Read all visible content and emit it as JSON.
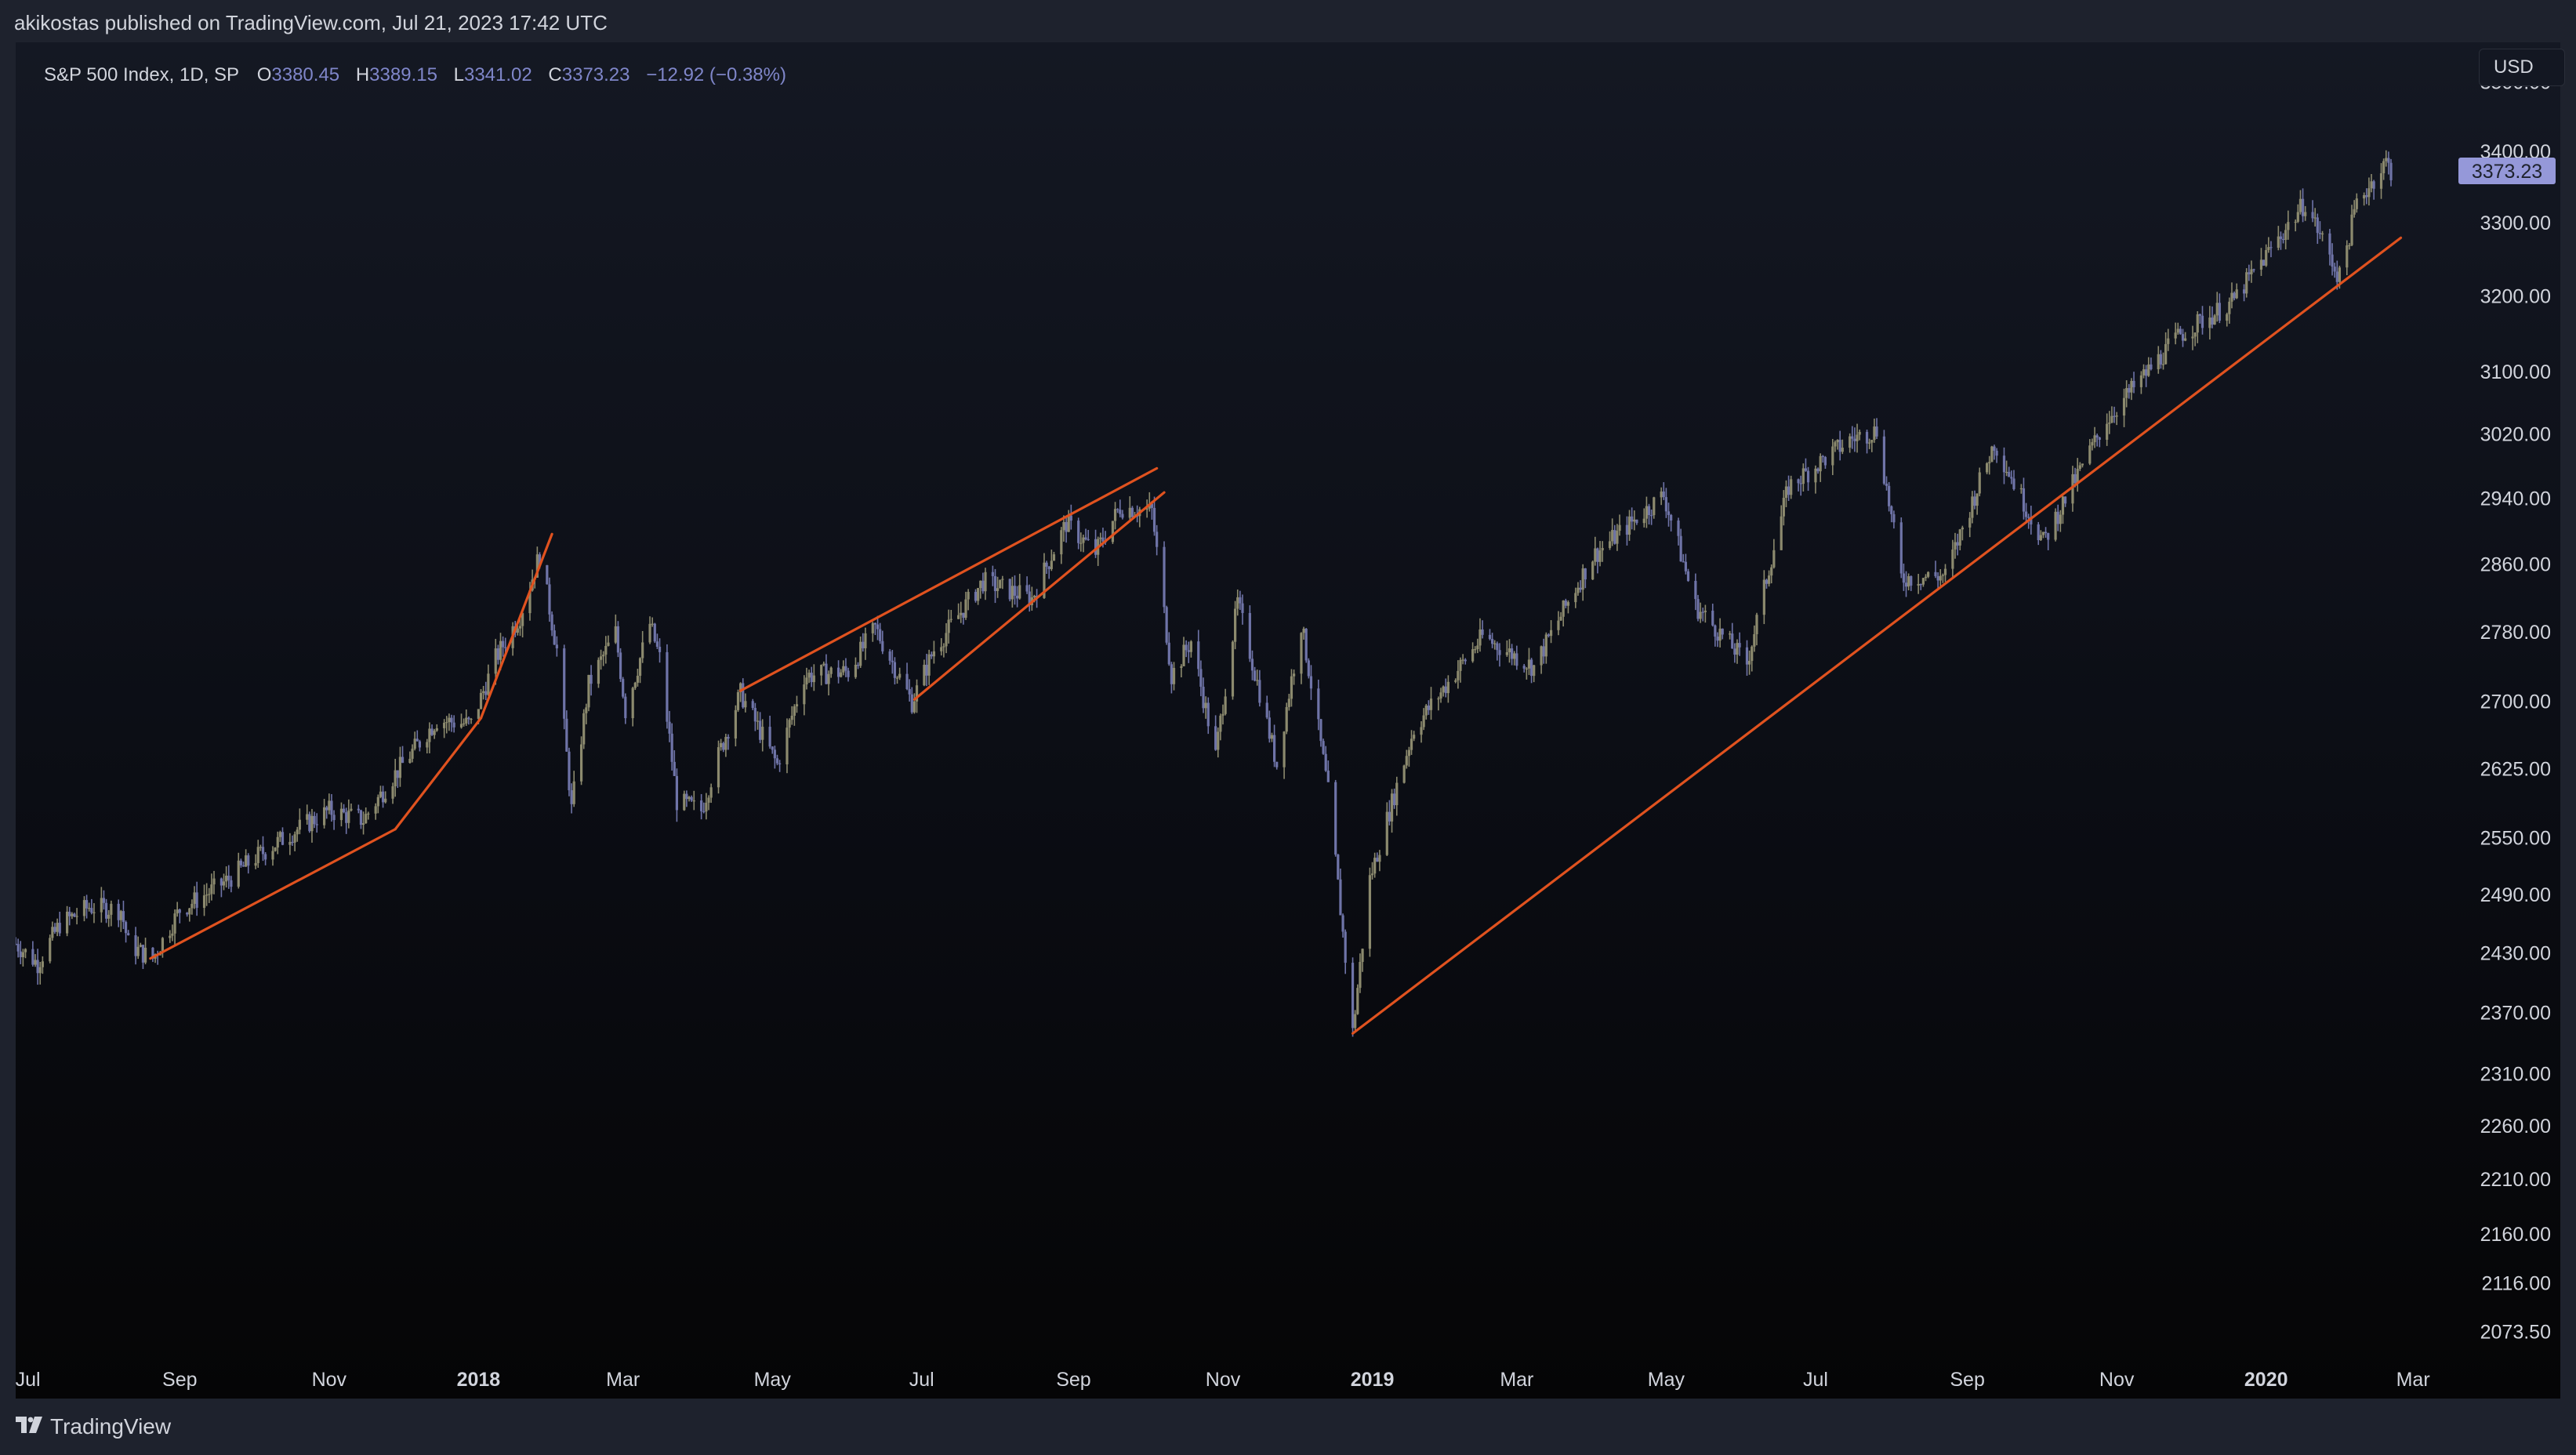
{
  "header": {
    "publish_info": "akikostas published on TradingView.com, Jul 21, 2023 17:42 UTC"
  },
  "legend": {
    "symbol": "S&P 500 Index, 1D, SP",
    "open_key": "O",
    "open": "3380.45",
    "high_key": "H",
    "high": "3389.15",
    "low_key": "L",
    "low": "3341.02",
    "close_key": "C",
    "close": "3373.23",
    "change": "−12.92 (−0.38%)"
  },
  "currency_button": "USD",
  "footer": {
    "brand": "TradingView"
  },
  "colors": {
    "trendline": "#e0521f",
    "price_tag_bg": "#9598d9",
    "bull": "#8c8a6e",
    "bear": "#6f74a8",
    "axis_text": "#d1d4dc"
  },
  "chart_data": {
    "type": "candlestick",
    "symbol": "S&P 500 Index",
    "interval": "1D",
    "exchange": "SP",
    "x_range": [
      "2017-06-26",
      "2020-03-08"
    ],
    "y_range": [
      2050,
      3560
    ],
    "y_scale": "log",
    "last_price": "3373.23",
    "y_ticks": [
      "3500.00",
      "3400.00",
      "3300.00",
      "3200.00",
      "3100.00",
      "3020.00",
      "2940.00",
      "2860.00",
      "2780.00",
      "2700.00",
      "2625.00",
      "2550.00",
      "2490.00",
      "2430.00",
      "2370.00",
      "2310.00",
      "2260.00",
      "2210.00",
      "2160.00",
      "2116.00",
      "2073.50"
    ],
    "x_ticks": [
      {
        "label": "Jul",
        "date": "2017-07-01",
        "bold": false
      },
      {
        "label": "Sep",
        "date": "2017-09-01",
        "bold": false
      },
      {
        "label": "Nov",
        "date": "2017-11-01",
        "bold": false
      },
      {
        "label": "2018",
        "date": "2018-01-01",
        "bold": true
      },
      {
        "label": "Mar",
        "date": "2018-03-01",
        "bold": false
      },
      {
        "label": "May",
        "date": "2018-05-01",
        "bold": false
      },
      {
        "label": "Jul",
        "date": "2018-07-01",
        "bold": false
      },
      {
        "label": "Sep",
        "date": "2018-09-01",
        "bold": false
      },
      {
        "label": "Nov",
        "date": "2018-11-01",
        "bold": false
      },
      {
        "label": "2019",
        "date": "2019-01-01",
        "bold": true
      },
      {
        "label": "Mar",
        "date": "2019-03-01",
        "bold": false
      },
      {
        "label": "May",
        "date": "2019-05-01",
        "bold": false
      },
      {
        "label": "Jul",
        "date": "2019-07-01",
        "bold": false
      },
      {
        "label": "Sep",
        "date": "2019-09-01",
        "bold": false
      },
      {
        "label": "Nov",
        "date": "2019-11-01",
        "bold": false
      },
      {
        "label": "2020",
        "date": "2020-01-01",
        "bold": true
      },
      {
        "label": "Mar",
        "date": "2020-03-01",
        "bold": false
      }
    ],
    "price_path": [
      [
        "2017-06-26",
        2440
      ],
      [
        "2017-07-05",
        2420
      ],
      [
        "2017-07-14",
        2460
      ],
      [
        "2017-07-26",
        2478
      ],
      [
        "2017-08-08",
        2475
      ],
      [
        "2017-08-11",
        2440
      ],
      [
        "2017-08-17",
        2430
      ],
      [
        "2017-08-21",
        2425
      ],
      [
        "2017-09-01",
        2475
      ],
      [
        "2017-09-11",
        2490
      ],
      [
        "2017-09-20",
        2505
      ],
      [
        "2017-10-02",
        2530
      ],
      [
        "2017-10-16",
        2555
      ],
      [
        "2017-11-01",
        2580
      ],
      [
        "2017-11-15",
        2570
      ],
      [
        "2017-11-28",
        2620
      ],
      [
        "2017-12-15",
        2680
      ],
      [
        "2017-12-29",
        2675
      ],
      [
        "2018-01-08",
        2750
      ],
      [
        "2018-01-18",
        2800
      ],
      [
        "2018-01-26",
        2872
      ],
      [
        "2018-02-02",
        2760
      ],
      [
        "2018-02-08",
        2581
      ],
      [
        "2018-02-15",
        2720
      ],
      [
        "2018-02-26",
        2780
      ],
      [
        "2018-03-02",
        2690
      ],
      [
        "2018-03-12",
        2790
      ],
      [
        "2018-03-16",
        2750
      ],
      [
        "2018-03-23",
        2590
      ],
      [
        "2018-04-02",
        2580
      ],
      [
        "2018-04-09",
        2640
      ],
      [
        "2018-04-18",
        2710
      ],
      [
        "2018-05-03",
        2630
      ],
      [
        "2018-05-14",
        2730
      ],
      [
        "2018-06-01",
        2735
      ],
      [
        "2018-06-12",
        2785
      ],
      [
        "2018-06-27",
        2700
      ],
      [
        "2018-07-06",
        2760
      ],
      [
        "2018-07-26",
        2840
      ],
      [
        "2018-08-15",
        2820
      ],
      [
        "2018-08-29",
        2910
      ],
      [
        "2018-09-10",
        2875
      ],
      [
        "2018-09-20",
        2930
      ],
      [
        "2018-10-03",
        2925
      ],
      [
        "2018-10-11",
        2730
      ],
      [
        "2018-10-19",
        2770
      ],
      [
        "2018-10-29",
        2640
      ],
      [
        "2018-11-07",
        2815
      ],
      [
        "2018-11-23",
        2630
      ],
      [
        "2018-12-03",
        2790
      ],
      [
        "2018-12-14",
        2600
      ],
      [
        "2018-12-24",
        2351
      ],
      [
        "2018-12-31",
        2507
      ],
      [
        "2019-01-18",
        2670
      ],
      [
        "2019-02-15",
        2775
      ],
      [
        "2019-03-08",
        2740
      ],
      [
        "2019-04-01",
        2870
      ],
      [
        "2019-04-30",
        2945
      ],
      [
        "2019-05-13",
        2811
      ],
      [
        "2019-06-03",
        2744
      ],
      [
        "2019-06-20",
        2955
      ],
      [
        "2019-07-15",
        3014
      ],
      [
        "2019-07-26",
        3026
      ],
      [
        "2019-08-05",
        2844
      ],
      [
        "2019-08-23",
        2847
      ],
      [
        "2019-09-12",
        3010
      ],
      [
        "2019-10-02",
        2887
      ],
      [
        "2019-10-28",
        3040
      ],
      [
        "2019-11-27",
        3150
      ],
      [
        "2019-12-18",
        3192
      ],
      [
        "2020-01-17",
        3329
      ],
      [
        "2020-01-31",
        3225
      ],
      [
        "2020-02-07",
        3328
      ],
      [
        "2020-02-19",
        3386
      ],
      [
        "2020-02-21",
        3373.23
      ]
    ],
    "trendlines": [
      {
        "from": [
          "2017-08-20",
          2425
        ],
        "to": [
          "2017-11-28",
          2560
        ]
      },
      {
        "from": [
          "2017-11-28",
          2560
        ],
        "to": [
          "2018-01-02",
          2682
        ]
      },
      {
        "from": [
          "2018-01-02",
          2682
        ],
        "to": [
          "2018-01-31",
          2897
        ]
      },
      {
        "from": [
          "2018-04-18",
          2713
        ],
        "to": [
          "2018-10-05",
          2978
        ]
      },
      {
        "from": [
          "2018-06-28",
          2703
        ],
        "to": [
          "2018-10-08",
          2948
        ]
      },
      {
        "from": [
          "2018-12-24",
          2350
        ],
        "to": [
          "2020-02-25",
          3280
        ]
      }
    ]
  }
}
